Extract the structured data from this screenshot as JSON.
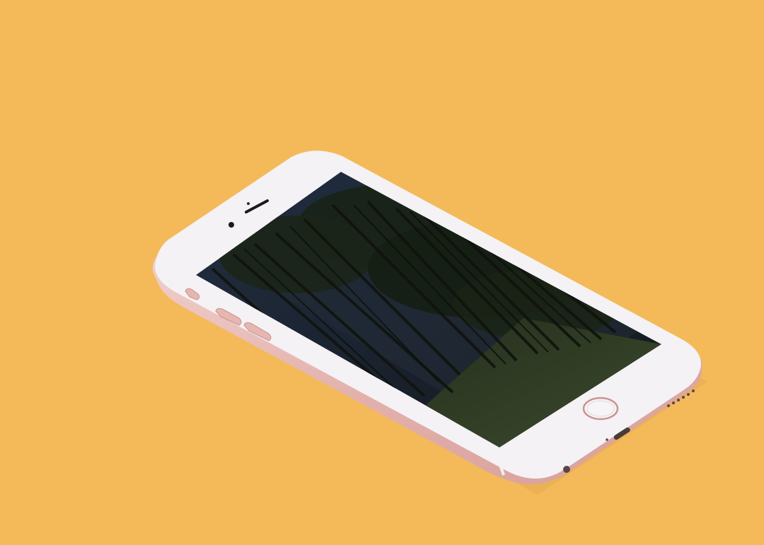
{
  "scene": {
    "subject": "phone-mockup",
    "background_color": "#F4BA5A",
    "phone": {
      "body_color": "#E9BDB8",
      "front_panel_color": "#F4F2F5",
      "screen_content": "forest-photo",
      "screen_colors": {
        "sky": "#243040",
        "canopy": "#1E2A1C",
        "trunks": "#151A12",
        "grass": "#3A4A2E"
      }
    }
  }
}
